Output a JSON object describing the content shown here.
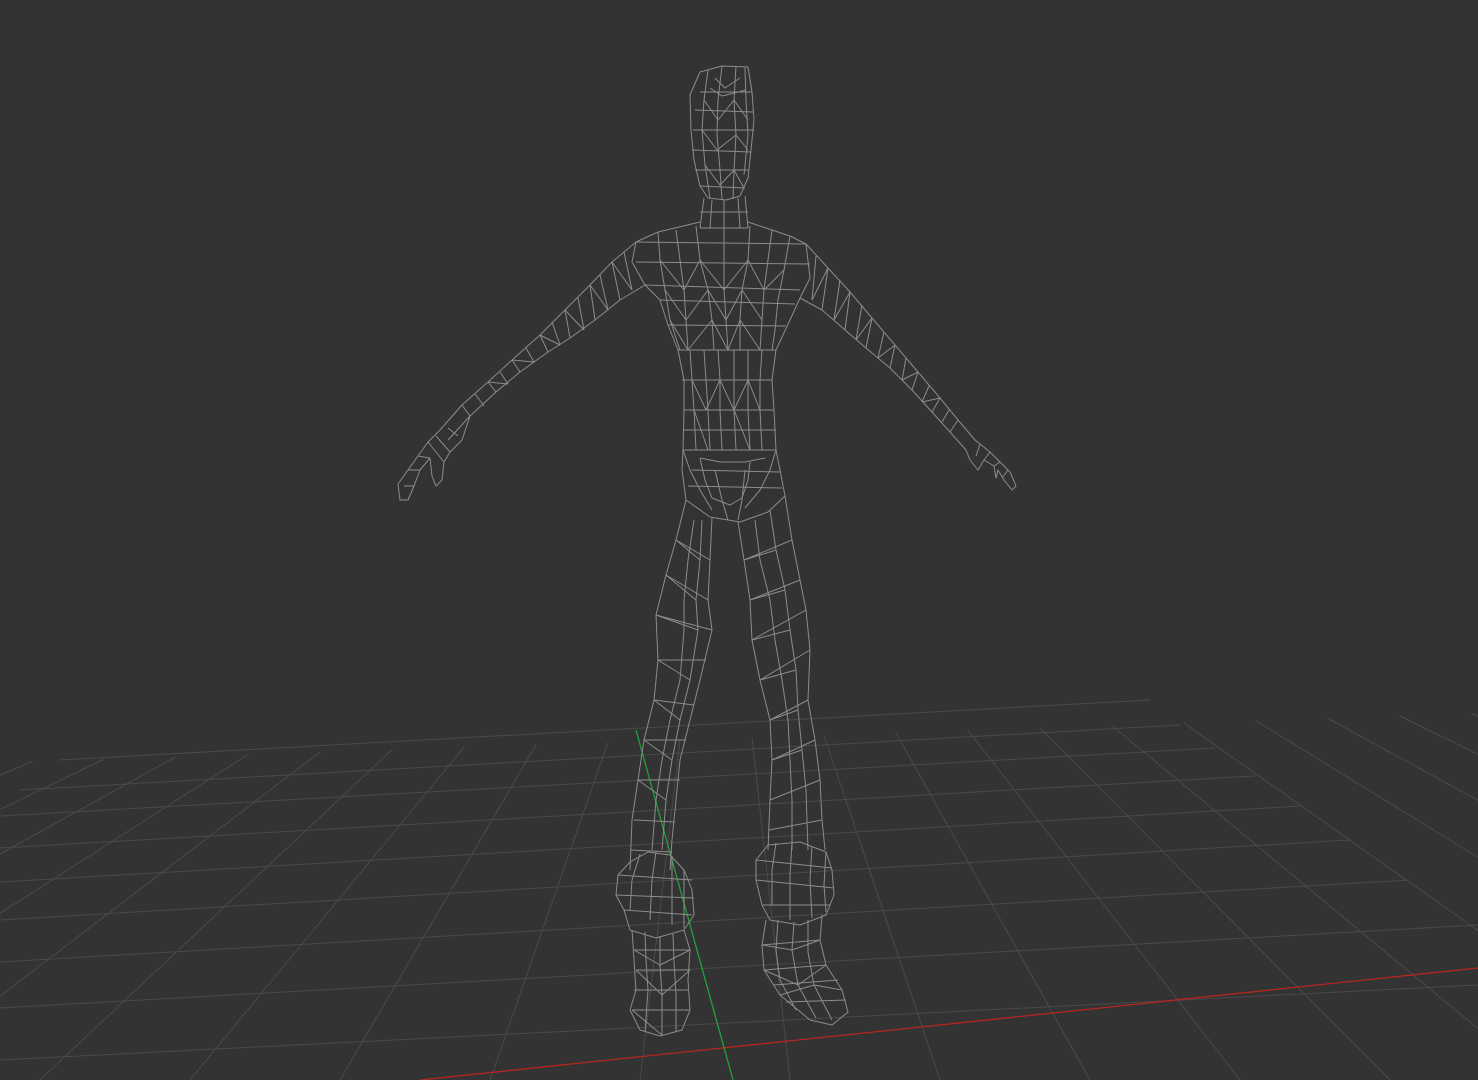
{
  "viewport": {
    "render_mode": "wireframe",
    "background_color": "#333333",
    "grid_color": "#4a4a4a",
    "x_axis_color": "#b3261e",
    "y_axis_color": "#1fa23a",
    "mesh_color": "#8c8c8c"
  },
  "model": {
    "name": "",
    "pose": "T-pose"
  }
}
